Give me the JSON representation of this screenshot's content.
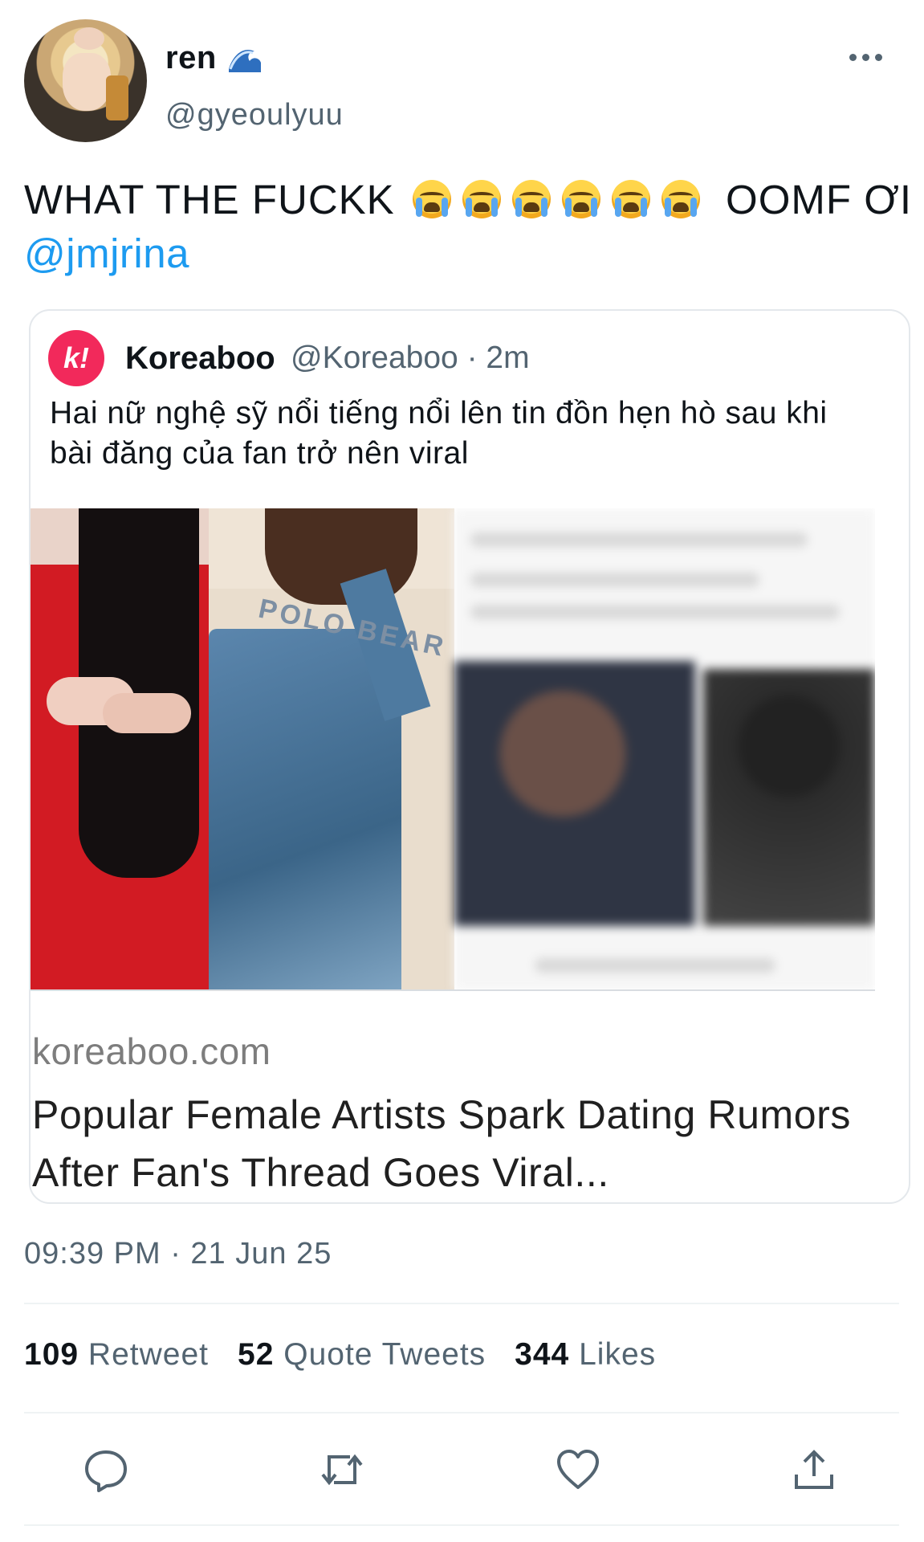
{
  "author": {
    "display_name": "ren",
    "name_emoji": "wave-emoji",
    "handle": "@gyeoulyuu",
    "avatar": "avatar-photo"
  },
  "tweet": {
    "text_before": "WHAT THE FUCKK",
    "emoji": [
      "loudly-crying-face",
      "loudly-crying-face",
      "loudly-crying-face",
      "loudly-crying-face",
      "loudly-crying-face",
      "loudly-crying-face"
    ],
    "text_after": "OOMF ƠI",
    "mention": "@jmjrina"
  },
  "quote": {
    "logo_letter": "k!",
    "name": "Koreaboo",
    "handle_time": "@Koreaboo · 2m",
    "text": "Hai nữ nghệ sỹ nổi tiếng nổi lên tin đồn hẹn hò sau khi bài đăng của fan trở nên viral",
    "link_domain": "koreaboo.com",
    "link_title": "Popular Female Artists Spark Dating Rumors After Fan's Thread Goes Viral...",
    "shirt_text": "POLO BEAR"
  },
  "timestamp": "09:39 PM · 21 Jun 25",
  "stats": {
    "retweets": "109",
    "retweets_label": "Retweet",
    "quotes": "52",
    "quotes_label": "Quote Tweets",
    "likes": "344",
    "likes_label": "Likes"
  },
  "actions": [
    "reply-icon",
    "retweet-icon",
    "like-icon",
    "share-icon"
  ],
  "colors": {
    "link": "#1d9bf0",
    "secondary": "#536471",
    "koreaboo_brand": "#f2295b"
  }
}
